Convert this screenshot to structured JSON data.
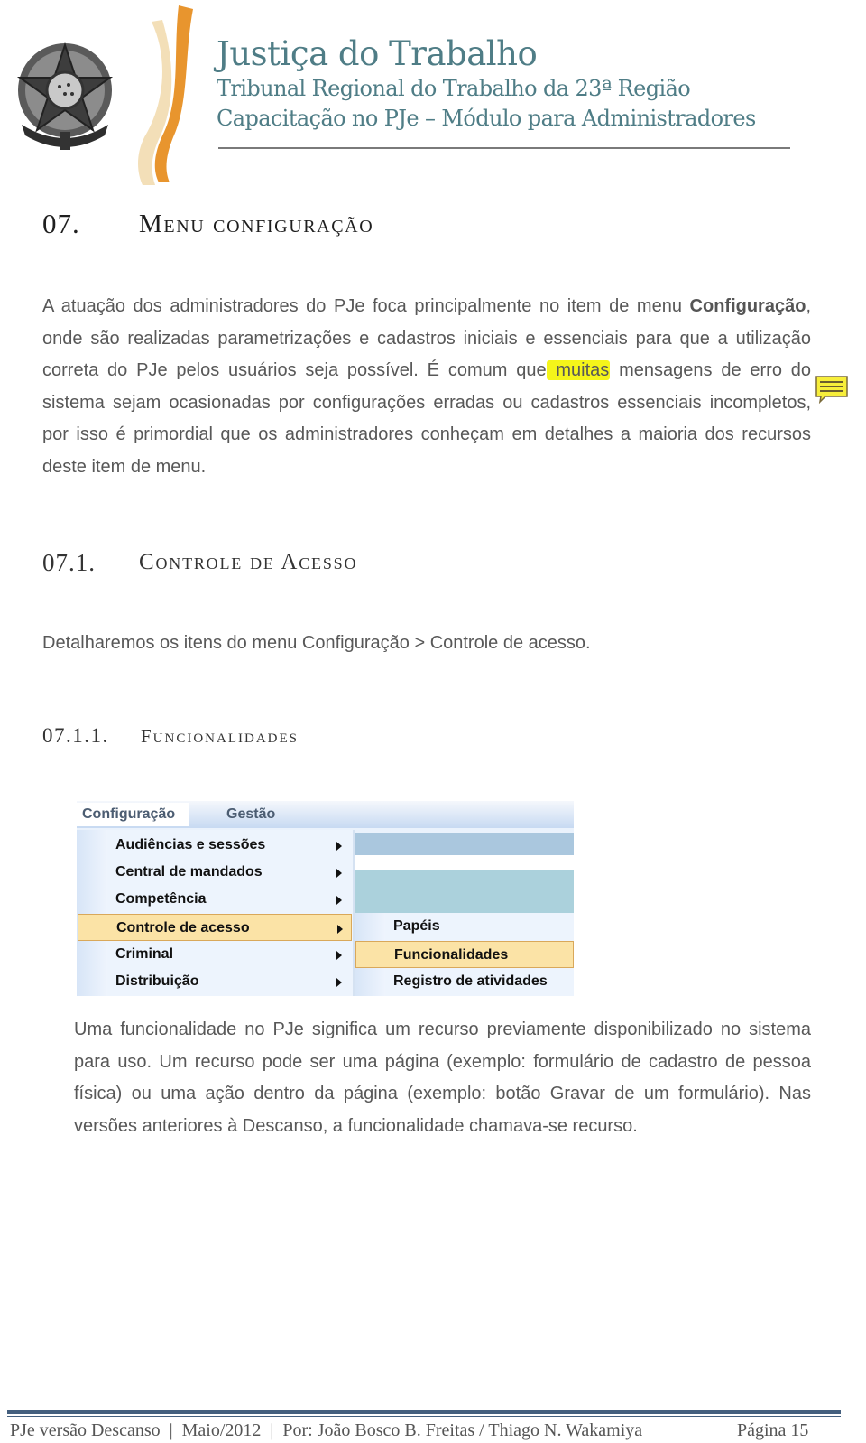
{
  "header": {
    "title": "Justiça do Trabalho",
    "subtitle1": "Tribunal Regional do Trabalho da 23ª Região",
    "subtitle2": "Capacitação no PJe – Módulo para Administradores"
  },
  "section1": {
    "number": "07.",
    "title": "Menu configuração",
    "paragraph": {
      "before_bold": "A atuação dos administradores do PJe foca principalmente no item de menu ",
      "bold": "Configuração",
      "after_bold": ", onde são realizadas parametrizações e cadastros iniciais e essenciais para que a utilização correta do PJe pelos usuários seja possível. É comum que",
      "highlight": " muitas",
      "rest": " mensagens de erro do sistema sejam ocasionadas por configurações erradas ou cadastros essenciais incompletos, por isso é primordial que os administradores conheçam em detalhes a maioria dos recursos deste item de menu."
    }
  },
  "section2": {
    "number": "07.1.",
    "title": "Controle de Acesso",
    "paragraph": "Detalharemos os itens do menu Configuração > Controle de acesso."
  },
  "section3": {
    "number": "07.1.1.",
    "title": "Funcionalidades",
    "paragraph": "Uma funcionalidade no PJe significa um recurso previamente disponibilizado no sistema para uso. Um recurso pode ser uma página (exemplo: formulário de cadastro de pessoa física) ou uma ação dentro da página (exemplo: botão Gravar de um formulário). Nas versões anteriores à Descanso, a funcionalidade chamava-se recurso."
  },
  "menu_screenshot": {
    "tabs": [
      {
        "label": "Configuração",
        "active": true
      },
      {
        "label": "Gestão",
        "active": false
      }
    ],
    "items": [
      {
        "label": "Audiências e sessões",
        "has_submenu": true,
        "selected": false
      },
      {
        "label": "Central de mandados",
        "has_submenu": true,
        "selected": false
      },
      {
        "label": "Competência",
        "has_submenu": true,
        "selected": false
      },
      {
        "label": "Controle de acesso",
        "has_submenu": true,
        "selected": true
      },
      {
        "label": "Criminal",
        "has_submenu": true,
        "selected": false
      },
      {
        "label": "Distribuição",
        "has_submenu": true,
        "selected": false
      }
    ],
    "submenu": [
      {
        "label": "Papéis",
        "selected": false
      },
      {
        "label": "Funcionalidades",
        "selected": true
      },
      {
        "label": "Registro de atividades",
        "selected": false
      }
    ]
  },
  "annotation": {
    "icon": "comment-icon",
    "highlight_color": "#f5f51a"
  },
  "footer": {
    "text": "PJe versão Descanso  |  Maio/2012  |  Por: João Bosco B. Freitas / Thiago N. Wakamiya",
    "page": "Página 15"
  },
  "colors": {
    "header_text": "#4f7d86",
    "accent_orange": "#e8952e",
    "footer_bar": "#445f7e",
    "menu_selected": "#fbe3a6"
  }
}
